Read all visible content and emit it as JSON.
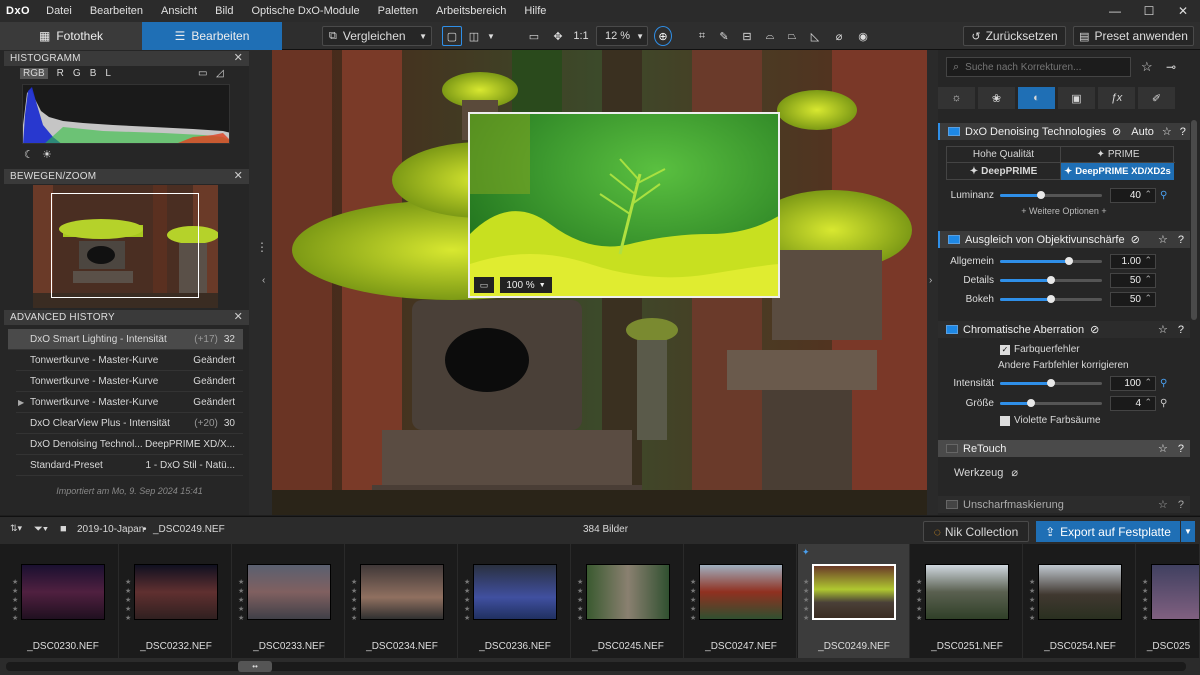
{
  "menubar": {
    "logo": "DxO",
    "items": [
      "Datei",
      "Bearbeiten",
      "Ansicht",
      "Bild",
      "Optische DxO-Module",
      "Paletten",
      "Arbeitsbereich",
      "Hilfe"
    ]
  },
  "toolbar": {
    "tab_library": "Fotothek",
    "tab_edit": "Bearbeiten",
    "compare": "Vergleichen",
    "ratio": "1:1",
    "zoom": "12 %",
    "reset": "Zurücksetzen",
    "apply_preset": "Preset anwenden"
  },
  "left": {
    "histogram": {
      "title": "HISTOGRAMM",
      "channels": [
        "RGB",
        "R",
        "G",
        "B",
        "L"
      ]
    },
    "move_zoom": {
      "title": "BEWEGEN/ZOOM"
    },
    "history": {
      "title": "ADVANCED HISTORY",
      "rows": [
        {
          "label": "DxO Smart Lighting - Intensität",
          "delta": "(+17)",
          "value": "32"
        },
        {
          "label": "Tonwertkurve - Master-Kurve",
          "delta": "",
          "value": "Geändert"
        },
        {
          "label": "Tonwertkurve - Master-Kurve",
          "delta": "",
          "value": "Geändert"
        },
        {
          "label": "Tonwertkurve - Master-Kurve",
          "delta": "",
          "value": "Geändert"
        },
        {
          "label": "DxO ClearView Plus - Intensität",
          "delta": "(+20)",
          "value": "30"
        },
        {
          "label": "DxO Denoising Technol...",
          "delta": "",
          "value": "DeepPRIME XD/X..."
        },
        {
          "label": "Standard-Preset",
          "delta": "",
          "value": "1 - DxO Stil - Natü..."
        }
      ],
      "imported": "Importiert am Mo, 9. Sep 2024 15:41"
    }
  },
  "viewer": {
    "loupe_zoom": "100 %"
  },
  "right": {
    "search_placeholder": "Suche nach Korrekturen...",
    "denoise": {
      "title": "DxO Denoising Technologies",
      "auto": "Auto",
      "opt1": "Hohe Qualität",
      "opt2": "PRIME",
      "opt3": "DeepPRIME",
      "opt4": "DeepPRIME XD/XD2s",
      "luminance_label": "Luminanz",
      "luminance": 40,
      "more": "+ Weitere Optionen +"
    },
    "unsharp": {
      "title": "Ausgleich von Objektivunschärfe",
      "rows": [
        {
          "label": "Allgemein",
          "value": "1.00",
          "pct": 0.68
        },
        {
          "label": "Details",
          "value": "50",
          "pct": 0.5
        },
        {
          "label": "Bokeh",
          "value": "50",
          "pct": 0.5
        }
      ]
    },
    "chroma": {
      "title": "Chromatische Aberration",
      "fringe": "Farbquerfehler",
      "other": "Andere Farbfehler korrigieren",
      "intensity_label": "Intensität",
      "intensity": "100",
      "intensity_pct": 0.5,
      "size_label": "Größe",
      "size": "4",
      "size_pct": 0.3,
      "violet": "Violette Farbsäume"
    },
    "retouch": {
      "title": "ReTouch",
      "tool": "Werkzeug"
    },
    "unsharp_mask": {
      "title": "Unscharfmaskierung"
    }
  },
  "filmstrip": {
    "folder": "2019-10-Japan",
    "file": "_DSC0249.NEF",
    "count": "384 Bilder",
    "nik": "Nik Collection",
    "export": "Export auf Festplatte",
    "thumbs": [
      "_DSC0230.NEF",
      "_DSC0232.NEF",
      "_DSC0233.NEF",
      "_DSC0234.NEF",
      "_DSC0236.NEF",
      "_DSC0245.NEF",
      "_DSC0247.NEF",
      "_DSC0249.NEF",
      "_DSC0251.NEF",
      "_DSC0254.NEF",
      "_DSC025"
    ]
  }
}
